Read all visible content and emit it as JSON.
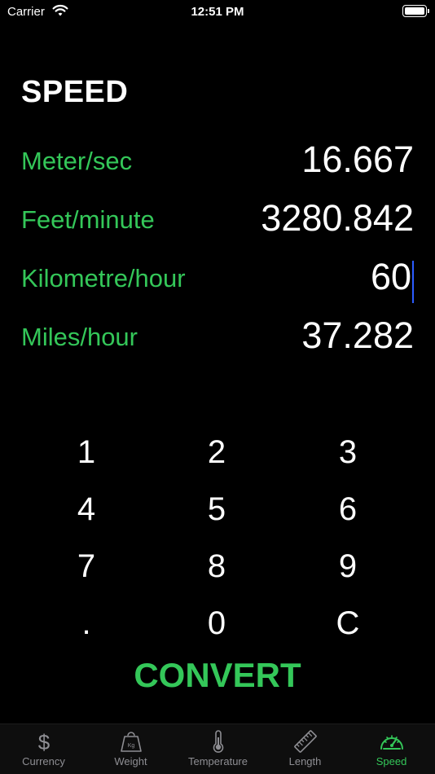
{
  "status_bar": {
    "carrier": "Carrier",
    "time": "12:51 PM"
  },
  "screen": {
    "title": "SPEED"
  },
  "conversions": [
    {
      "label": "Meter/sec",
      "value": "16.667"
    },
    {
      "label": "Feet/minute",
      "value": "3280.842"
    },
    {
      "label": "Kilometre/hour",
      "value": "60"
    },
    {
      "label": "Miles/hour",
      "value": "37.282"
    }
  ],
  "keypad": {
    "rows": [
      [
        "1",
        "2",
        "3"
      ],
      [
        "4",
        "5",
        "6"
      ],
      [
        "7",
        "8",
        "9"
      ],
      [
        ".",
        "0",
        "C"
      ]
    ]
  },
  "convert_label": "CONVERT",
  "tabs": [
    {
      "label": "Currency",
      "icon": "dollar-icon"
    },
    {
      "label": "Weight",
      "icon": "weight-icon"
    },
    {
      "label": "Temperature",
      "icon": "thermometer-icon"
    },
    {
      "label": "Length",
      "icon": "ruler-icon"
    },
    {
      "label": "Speed",
      "icon": "speedometer-icon"
    }
  ],
  "active_tab": "Speed",
  "colors": {
    "accent": "#34c759",
    "background": "#000000",
    "inactive": "#8e8e93",
    "caret": "#2b5cff"
  }
}
